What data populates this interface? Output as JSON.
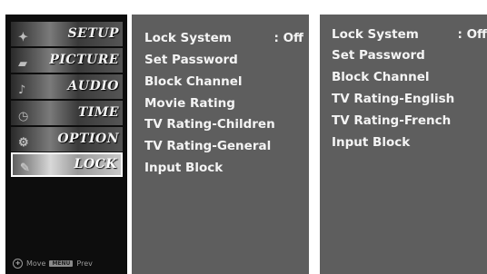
{
  "sidebar": {
    "items": [
      {
        "label": "SETUP",
        "active": false
      },
      {
        "label": "PICTURE",
        "active": false
      },
      {
        "label": "AUDIO",
        "active": false
      },
      {
        "label": "TIME",
        "active": false
      },
      {
        "label": "OPTION",
        "active": false
      },
      {
        "label": "LOCK",
        "active": true
      }
    ],
    "footer": {
      "move_label": "Move",
      "prev_key": "MENU",
      "prev_label": "Prev"
    }
  },
  "menu_primary": {
    "items": [
      {
        "label": "Lock System",
        "value": ": Off"
      },
      {
        "label": "Set Password",
        "value": ""
      },
      {
        "label": "Block Channel",
        "value": ""
      },
      {
        "label": "Movie Rating",
        "value": ""
      },
      {
        "label": "TV Rating-Children",
        "value": ""
      },
      {
        "label": "TV Rating-General",
        "value": ""
      },
      {
        "label": "Input Block",
        "value": ""
      }
    ]
  },
  "menu_secondary": {
    "items": [
      {
        "label": "Lock System",
        "value": ": Off"
      },
      {
        "label": "Set Password",
        "value": ""
      },
      {
        "label": "Block Channel",
        "value": ""
      },
      {
        "label": "TV Rating-English",
        "value": ""
      },
      {
        "label": "TV Rating-French",
        "value": ""
      },
      {
        "label": "Input Block",
        "value": ""
      }
    ]
  },
  "colors": {
    "panel": "#5e5e5e",
    "sidebar": "#0d0d0d",
    "text": "#f4f4f4"
  }
}
